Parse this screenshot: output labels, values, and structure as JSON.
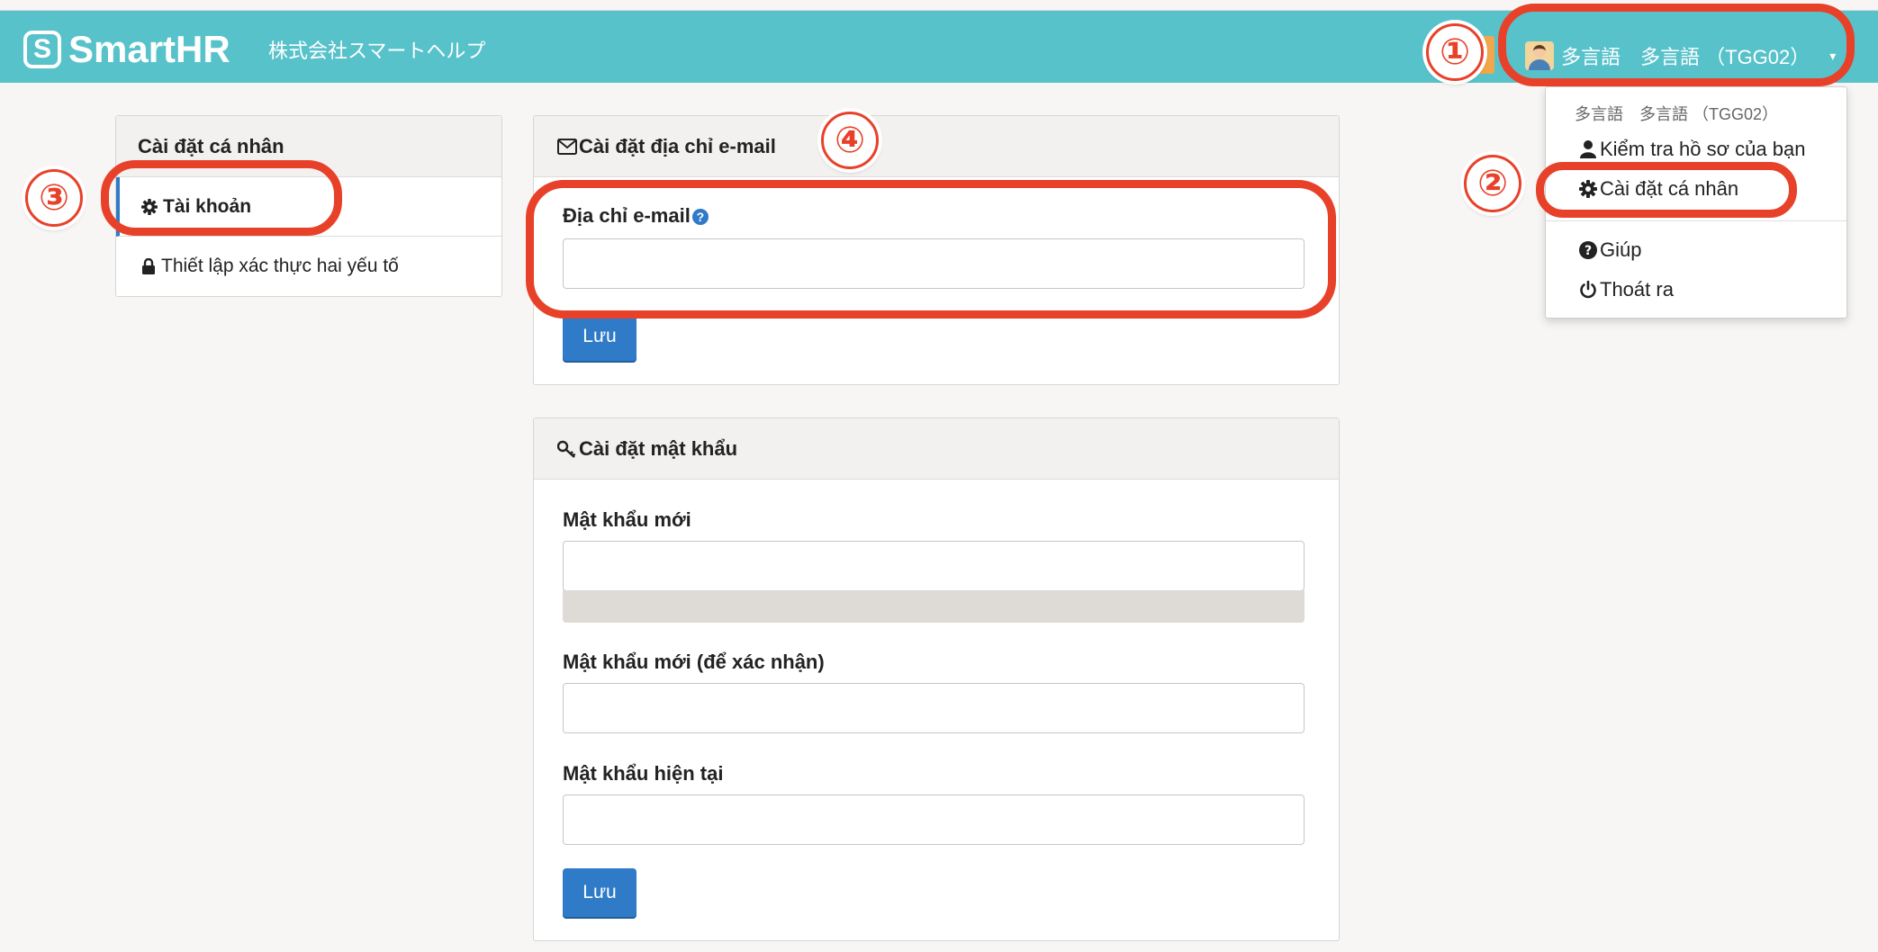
{
  "header": {
    "logo_mark": "S",
    "logo_text": "SmartHR",
    "company": "株式会社スマートヘルプ",
    "user_name": "多言語",
    "user_org": "多言語 （TGG02）",
    "caret": "▾"
  },
  "dropdown": {
    "header": "多言語　多言語 （TGG02）",
    "items": [
      {
        "label": "Kiểm tra hồ sơ của bạn",
        "icon": "user-icon"
      },
      {
        "label": "Cài đặt cá nhân",
        "icon": "gear-icon"
      },
      {
        "label": "Giúp",
        "icon": "question-circle-icon"
      },
      {
        "label": "Thoát ra",
        "icon": "power-icon"
      }
    ]
  },
  "sidebar": {
    "title": "Cài đặt cá nhân",
    "items": [
      {
        "label": "Tài khoản",
        "icon": "gear-icon",
        "active": true
      },
      {
        "label": "Thiết lập xác thực hai yếu tố",
        "icon": "lock-icon",
        "active": false
      }
    ]
  },
  "email_panel": {
    "title": "Cài đặt địa chỉ e-mail",
    "icon": "envelope-icon",
    "field_label": "Địa chỉ e-mail",
    "help": "?",
    "value": "",
    "save_label": "Lưu"
  },
  "password_panel": {
    "title": "Cài đặt mật khẩu",
    "icon": "key-icon",
    "new_label": "Mật khẩu mới",
    "confirm_label": "Mật khẩu mới (để xác nhận)",
    "current_label": "Mật khẩu hiện tại",
    "save_label": "Lưu"
  },
  "annotations": {
    "badge1": "①",
    "badge2": "②",
    "badge3": "③",
    "badge4": "④",
    "color": "#e8412a"
  },
  "colors": {
    "header_bg": "#58c2cb",
    "button": "#2f7bc8",
    "accent_orange": "#f0a64a"
  }
}
